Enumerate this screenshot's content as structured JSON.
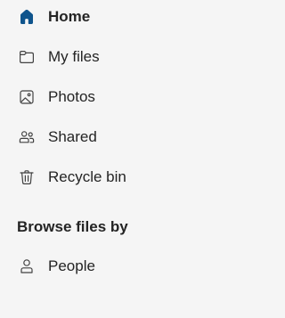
{
  "nav": {
    "items": [
      {
        "label": "Home",
        "icon": "home-icon",
        "active": true
      },
      {
        "label": "My files",
        "icon": "folder-icon",
        "active": false
      },
      {
        "label": "Photos",
        "icon": "image-icon",
        "active": false
      },
      {
        "label": "Shared",
        "icon": "people-icon",
        "active": false
      },
      {
        "label": "Recycle bin",
        "icon": "trash-icon",
        "active": false
      }
    ]
  },
  "browse": {
    "header": "Browse files by",
    "items": [
      {
        "label": "People",
        "icon": "person-icon"
      }
    ]
  },
  "colors": {
    "background": "#f5f5f5",
    "active_icon": "#0f548c",
    "text": "#242424",
    "icon_stroke": "#424242"
  }
}
